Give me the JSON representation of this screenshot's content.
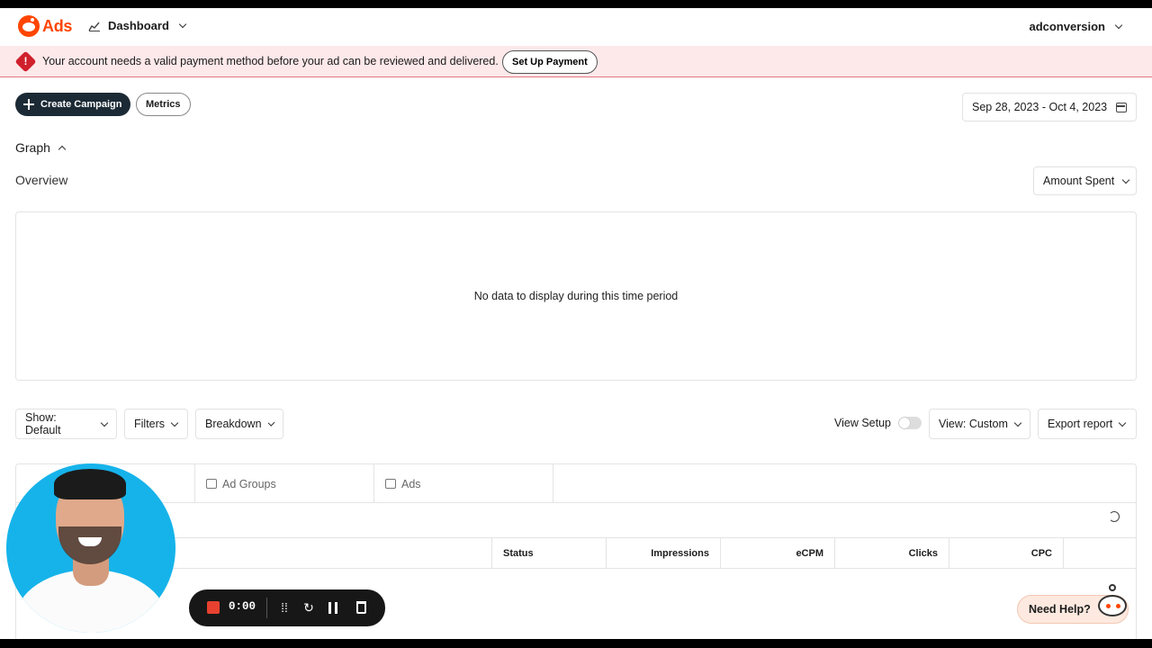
{
  "app": {
    "logo_text": "Ads",
    "brand_color": "#ff4500",
    "nav_label": "Dashboard",
    "account_name": "adconversion"
  },
  "alert": {
    "message": "Your account needs a valid payment method before your ad can be reviewed and delivered.",
    "button_label": "Set Up Payment",
    "icon": "alert-icon",
    "color": "#d0202c"
  },
  "toolbar": {
    "create_label": "Create Campaign",
    "metrics_label": "Metrics",
    "date_range": "Sep 28, 2023 - Oct 4, 2023"
  },
  "graph": {
    "section_title": "Graph",
    "subtitle": "Overview",
    "metric_select": "Amount Spent",
    "empty_message": "No data to display during this time period"
  },
  "controls": {
    "show": "Show: Default",
    "filters": "Filters",
    "breakdown": "Breakdown",
    "view_setup": "View Setup",
    "view": "View: Custom",
    "export": "Export report"
  },
  "table": {
    "tabs": [
      {
        "label": ""
      },
      {
        "label": "Ad Groups"
      },
      {
        "label": "Ads"
      }
    ],
    "columns": [
      "Status",
      "Impressions",
      "eCPM",
      "Clicks",
      "CPC"
    ]
  },
  "recorder": {
    "time": "0:00"
  },
  "help": {
    "label": "Need Help?"
  }
}
